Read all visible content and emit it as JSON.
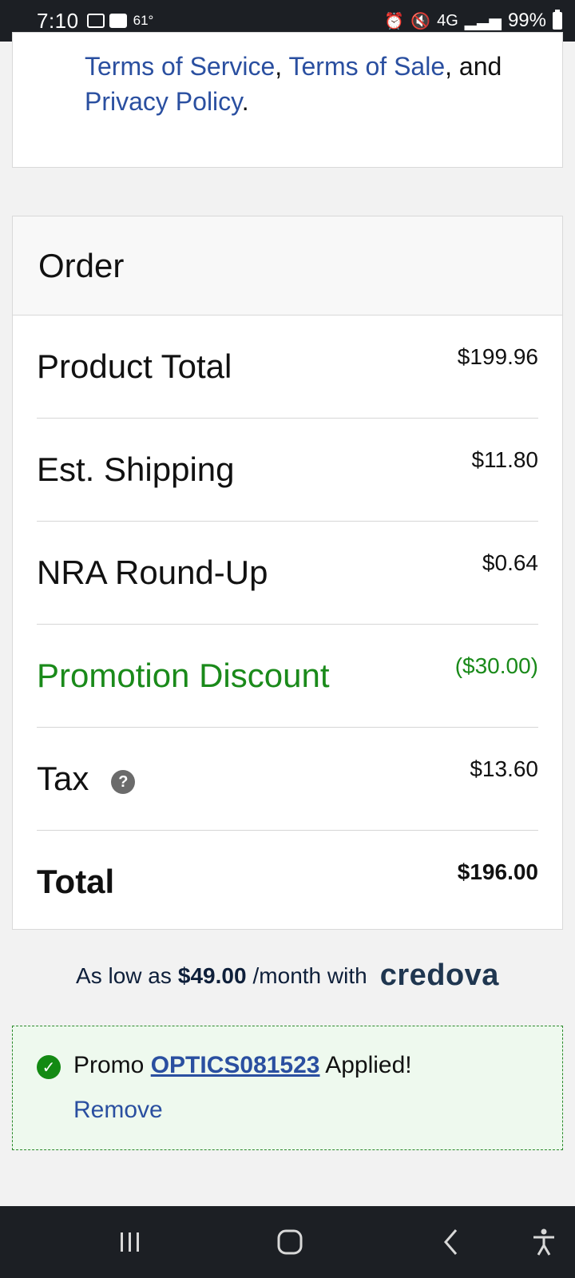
{
  "status_bar": {
    "time": "7:10",
    "temperature": "61°",
    "network": "4G",
    "battery_pct": "99%",
    "icons": [
      "video-call-icon",
      "image-icon",
      "alarm-icon",
      "mute-icon",
      "signal-icon",
      "battery-icon"
    ]
  },
  "terms": {
    "link_terms_service": "Terms of Service",
    "sep1": ", ",
    "link_terms_sale": "Terms of Sale",
    "sep2": ", and",
    "link_privacy": "Privacy Policy",
    "end": "."
  },
  "order": {
    "title": "Order",
    "rows": [
      {
        "label": "Product Total",
        "value": "$199.96"
      },
      {
        "label": "Est. Shipping",
        "value": "$11.80"
      },
      {
        "label": "NRA Round-Up",
        "value": "$0.64"
      },
      {
        "label": "Promotion Discount",
        "value": "($30.00)"
      },
      {
        "label": "Tax",
        "value": "$13.60",
        "help_icon": "?"
      },
      {
        "label": "Total",
        "value": "$196.00"
      }
    ]
  },
  "credova": {
    "prefix": "As low as",
    "amount": "$49.00",
    "suffix": "/month with",
    "logo": "credova"
  },
  "promo": {
    "prefix": "Promo",
    "code": "OPTICS081523",
    "suffix": "Applied!",
    "remove_label": "Remove"
  },
  "colors": {
    "link": "#2a4fa0",
    "promo_green": "#1a8a1a",
    "bar_dark": "#1c1f24"
  }
}
